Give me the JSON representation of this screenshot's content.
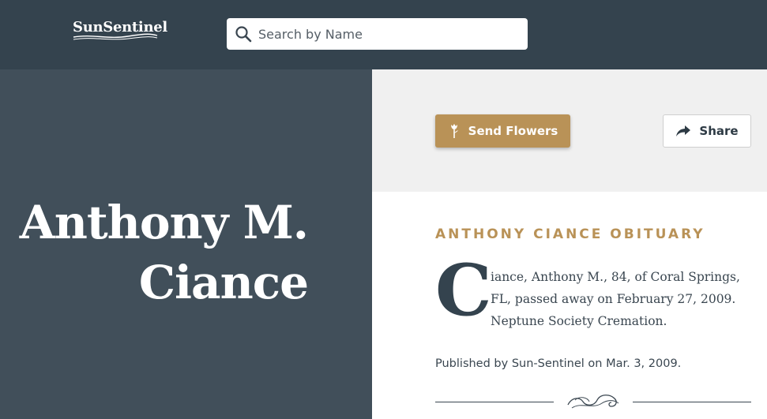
{
  "header": {
    "logo_text": "SunSentinel",
    "search": {
      "placeholder": "Search by Name",
      "value": ""
    }
  },
  "person": {
    "name_line1": "Anthony M.",
    "name_line2": "Ciance"
  },
  "actions": {
    "send_flowers_label": "Send Flowers",
    "share_label": "Share"
  },
  "obituary": {
    "heading": "ANTHONY CIANCE OBITUARY",
    "drop_cap": "C",
    "body": "iance, Anthony M., 84, of Coral Springs, FL, passed away on February 27, 2009. Neptune Society Cremation.",
    "published": "Published by Sun-Sentinel on Mar. 3, 2009."
  },
  "colors": {
    "header_bg": "#34434e",
    "name_panel_bg": "#414f5a",
    "accent_gold": "#b99257",
    "actions_bg": "#f0f0f0"
  },
  "icons": [
    "search-icon",
    "flower-icon",
    "share-arrow-icon",
    "flourish-ornament-icon"
  ]
}
